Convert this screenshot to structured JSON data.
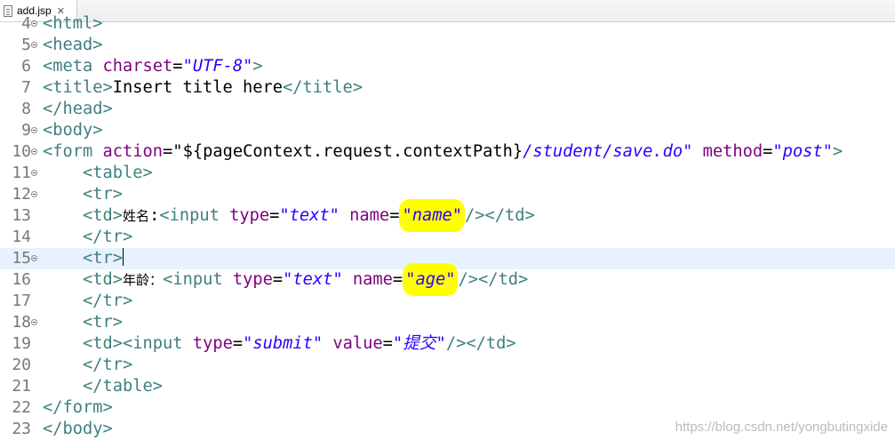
{
  "tab": {
    "title": "add.jsp",
    "close": "✕"
  },
  "lines": [
    {
      "num": "4",
      "text": "<html>"
    },
    {
      "num": "5",
      "text": "<head>"
    },
    {
      "num": "6",
      "text": "<meta charset=\"UTF-8\">"
    },
    {
      "num": "7",
      "text": "<title>Insert title here</title>"
    },
    {
      "num": "8",
      "text": "</head>"
    },
    {
      "num": "9",
      "text": "<body>"
    },
    {
      "num": "10",
      "text": "<form action=\"${pageContext.request.contextPath}/student/save.do\" method=\"post\">"
    },
    {
      "num": "11",
      "text": "    <table>"
    },
    {
      "num": "12",
      "text": "    <tr>"
    },
    {
      "num": "13",
      "text": "    <td>姓名:<input type=\"text\" name=\"name\"/></td>"
    },
    {
      "num": "14",
      "text": "    </tr>"
    },
    {
      "num": "15",
      "text": "    <tr>"
    },
    {
      "num": "16",
      "text": "    <td>年龄：<input type=\"text\" name=\"age\"/></td>"
    },
    {
      "num": "17",
      "text": "    </tr>"
    },
    {
      "num": "18",
      "text": "    <tr>"
    },
    {
      "num": "19",
      "text": "    <td><input type=\"submit\" value=\"提交\"/></td>"
    },
    {
      "num": "20",
      "text": "    </tr>"
    },
    {
      "num": "21",
      "text": "    </table>"
    },
    {
      "num": "22",
      "text": "</form>"
    },
    {
      "num": "23",
      "text": "</body>"
    }
  ],
  "watermark": "https://blog.csdn.net/yongbutingxide"
}
